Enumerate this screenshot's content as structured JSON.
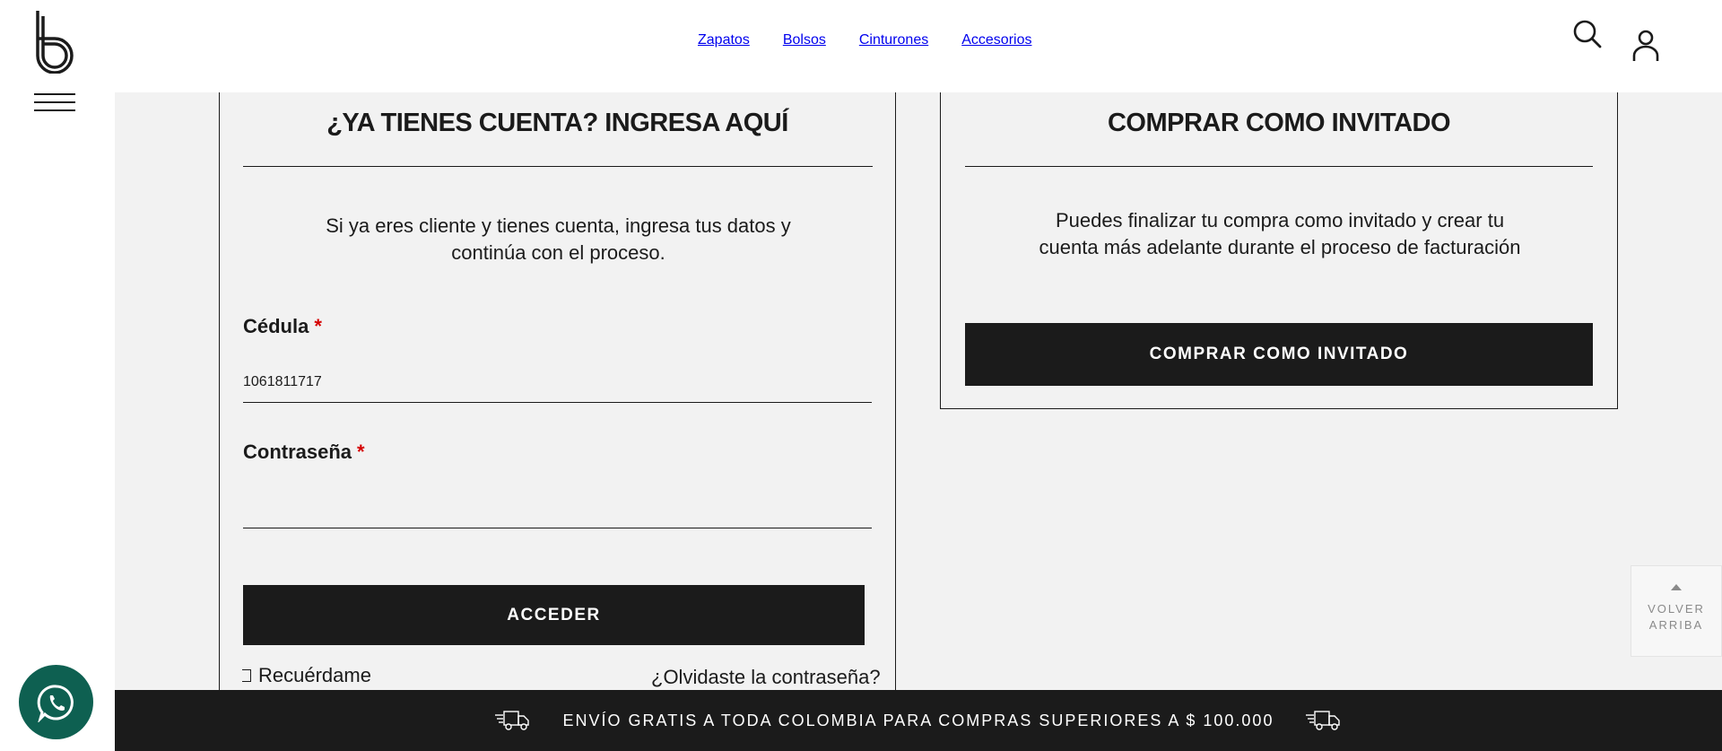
{
  "header": {
    "logo_letter": "b",
    "nav": [
      "Zapatos",
      "Bolsos",
      "Cinturones",
      "Accesorios"
    ],
    "search_icon": "search-icon",
    "user_icon": "user-icon"
  },
  "login": {
    "title": "¿YA TIENES CUENTA? INGRESA AQUÍ",
    "description": "Si ya eres cliente y tienes cuenta, ingresa tus datos y continúa con el proceso.",
    "id_label": "Cédula",
    "id_value": "1061811717",
    "password_label": "Contraseña",
    "password_value": "",
    "required_mark": "*",
    "submit_label": "ACCEDER",
    "remember_label": "Recuérdame",
    "forgot_label": "¿Olvidaste la contraseña?"
  },
  "guest": {
    "title": "COMPRAR COMO INVITADO",
    "description": "Puedes finalizar tu compra como invitado y crear tu cuenta más adelante durante el proceso de facturación",
    "button_label": "COMPRAR COMO INVITADO"
  },
  "shipping_banner": {
    "text": "ENVÍO GRATIS A TODA COLOMBIA PARA COMPRAS SUPERIORES A $ 100.000",
    "icon": "delivery-truck-icon"
  },
  "back_to_top": {
    "label": "VOLVER ARRIBA"
  },
  "whatsapp": {
    "icon": "whatsapp-icon",
    "color": "#0e6051"
  },
  "colors": {
    "dark": "#1b1b1b",
    "background": "#f2f2f2",
    "required": "#d50000"
  }
}
